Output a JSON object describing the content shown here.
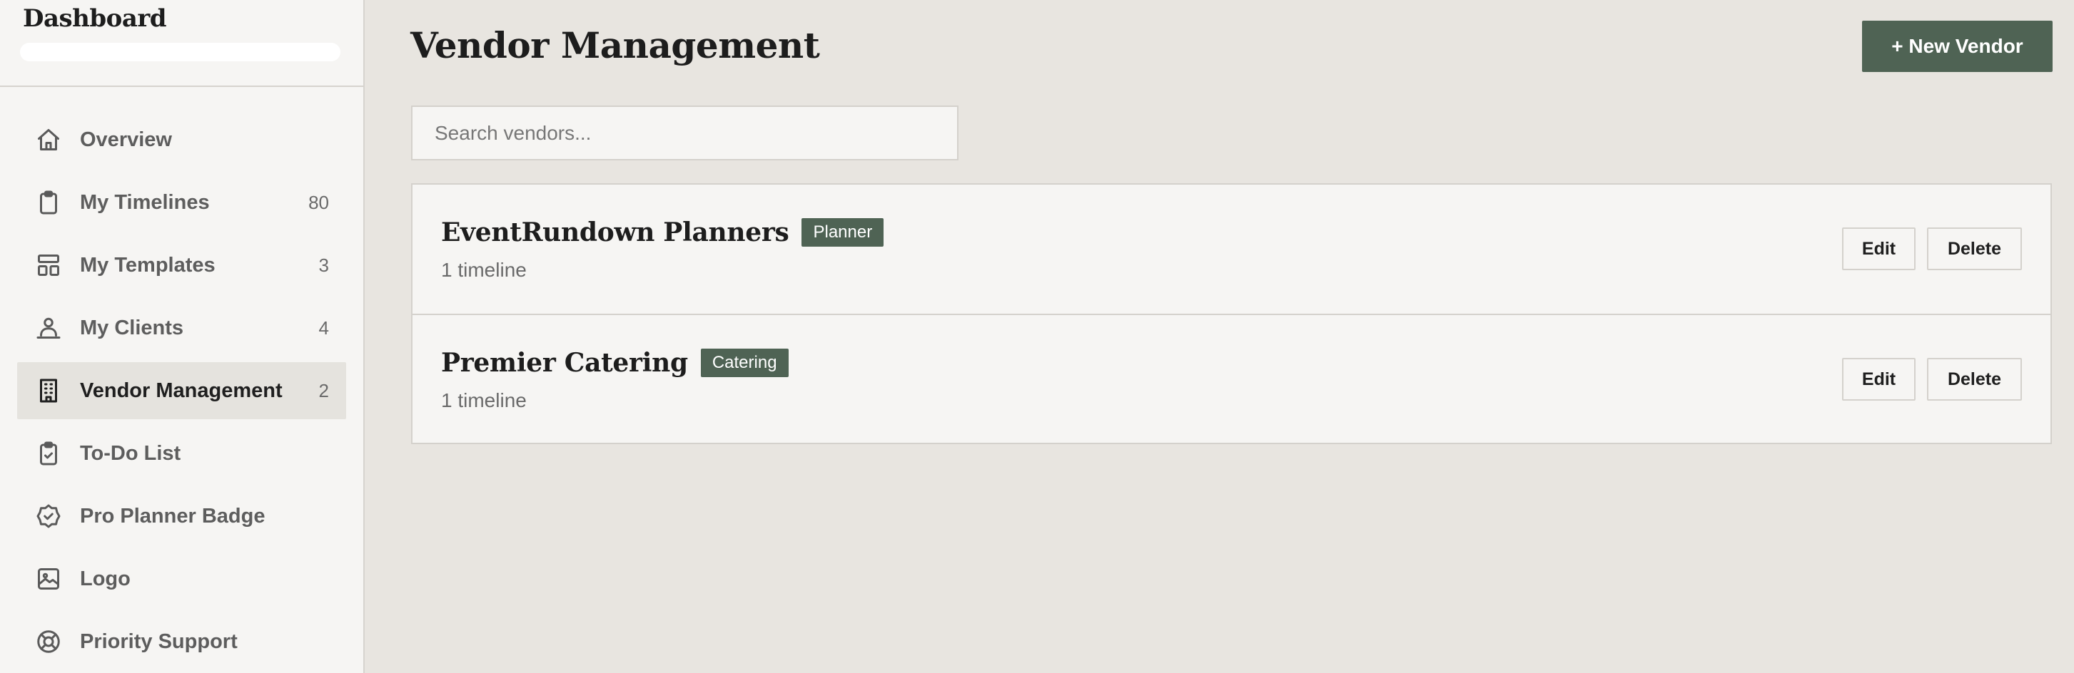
{
  "sidebar": {
    "brand": "Dashboard",
    "items": [
      {
        "label": "Overview",
        "count": "",
        "icon": "home-icon"
      },
      {
        "label": "My Timelines",
        "count": "80",
        "icon": "clipboard-icon"
      },
      {
        "label": "My Templates",
        "count": "3",
        "icon": "layout-icon"
      },
      {
        "label": "My Clients",
        "count": "4",
        "icon": "users-icon"
      },
      {
        "label": "Vendor Management",
        "count": "2",
        "icon": "building-icon",
        "active": true
      },
      {
        "label": "To-Do List",
        "count": "",
        "icon": "clipboard-check-icon"
      },
      {
        "label": "Pro Planner Badge",
        "count": "",
        "icon": "badge-check-icon"
      },
      {
        "label": "Logo",
        "count": "",
        "icon": "image-icon"
      },
      {
        "label": "Priority Support",
        "count": "",
        "icon": "lifebuoy-icon"
      }
    ]
  },
  "main": {
    "title": "Vendor Management",
    "new_button": "+ New Vendor",
    "search_placeholder": "Search vendors...",
    "vendors": [
      {
        "name": "EventRundown Planners",
        "tag": "Planner",
        "meta": "1 timeline",
        "edit": "Edit",
        "delete": "Delete"
      },
      {
        "name": "Premier Catering",
        "tag": "Catering",
        "meta": "1 timeline",
        "edit": "Edit",
        "delete": "Delete"
      }
    ]
  },
  "colors": {
    "accent": "#4f6354",
    "page_bg": "#e8e5e0",
    "panel_bg": "#f6f5f3",
    "border": "#d4d1cc"
  }
}
